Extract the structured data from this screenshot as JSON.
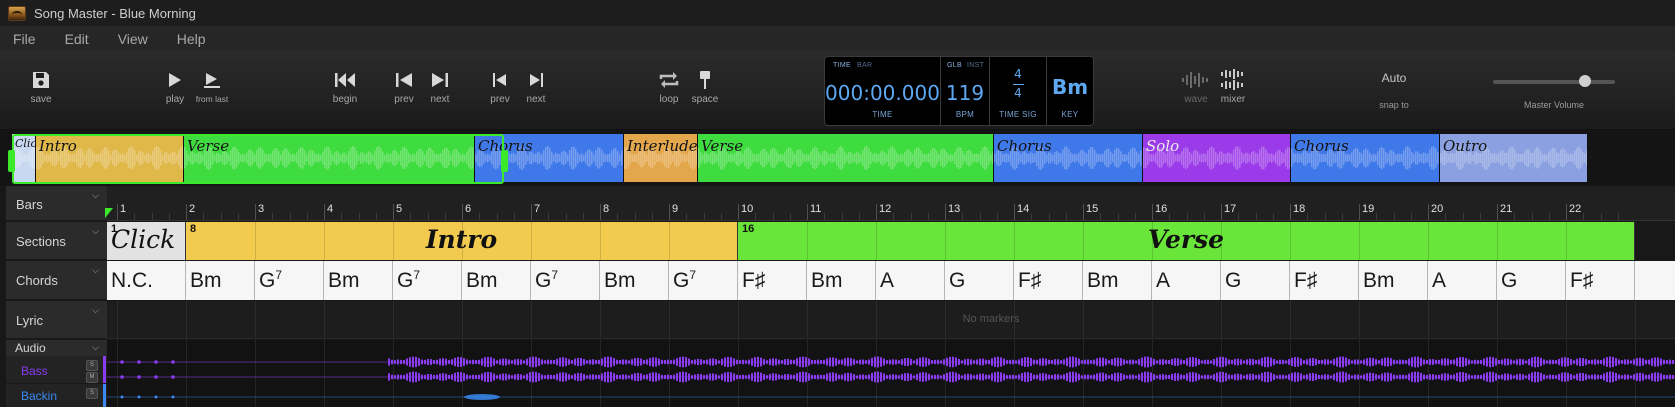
{
  "window": {
    "title": "Song Master - Blue Morning"
  },
  "menu": [
    "File",
    "Edit",
    "View",
    "Help"
  ],
  "toolbar": {
    "save": "save",
    "play": "play",
    "from_last": "from last",
    "begin": "begin",
    "prev_bar": "prev",
    "next_bar": "next",
    "prev_section": "prev",
    "next_section": "next",
    "loop": "loop",
    "space": "space",
    "wave": "wave",
    "mixer": "mixer"
  },
  "lcd": {
    "time_tag": "TIME",
    "bar_tag": "BAR",
    "time_value": "000:00.000",
    "time_label": "TIME",
    "glb_tag": "GLB",
    "inst_tag": "INST",
    "bpm_value": "119",
    "bpm_label": "BPM",
    "timesig_top": "4",
    "timesig_bottom": "4",
    "timesig_label": "TIME SIG",
    "key_value": "Bm",
    "key_label": "KEY"
  },
  "snap": {
    "value": "Auto",
    "label": "snap to"
  },
  "master_volume": {
    "label": "Master Volume",
    "level": 0.75
  },
  "overview_sections": [
    {
      "name": "Click",
      "color": "#c8d8f0"
    },
    {
      "name": "Intro",
      "color": "#e0b84a"
    },
    {
      "name": "Verse",
      "color": "#3fdc3f"
    },
    {
      "name": "Chorus",
      "color": "#3f78e8"
    },
    {
      "name": "Interlude",
      "color": "#e4a64a"
    },
    {
      "name": "Verse",
      "color": "#3fdc3f"
    },
    {
      "name": "Chorus",
      "color": "#3f78e8"
    },
    {
      "name": "Solo",
      "color": "#9a3ae8"
    },
    {
      "name": "Chorus",
      "color": "#3f78e8"
    },
    {
      "name": "Outro",
      "color": "#8aa0e0"
    }
  ],
  "track_headers": {
    "bars": "Bars",
    "sections": "Sections",
    "chords": "Chords",
    "lyric": "Lyric",
    "audio": "Audio"
  },
  "bar_numbers": [
    "1",
    "2",
    "3",
    "4",
    "5",
    "6",
    "7",
    "8",
    "9",
    "10",
    "11",
    "12",
    "13",
    "14",
    "15",
    "16",
    "17",
    "18",
    "19",
    "20",
    "21",
    "22"
  ],
  "sections": [
    {
      "number": "1",
      "name": "Click",
      "color": "#e2e2e2"
    },
    {
      "number": "8",
      "name": "Intro",
      "color": "#f2cb4e"
    },
    {
      "number": "16",
      "name": "Verse",
      "color": "#6ae63a"
    }
  ],
  "chords": [
    {
      "root": "N.C.",
      "ext": ""
    },
    {
      "root": "Bm",
      "ext": ""
    },
    {
      "root": "G",
      "ext": "7"
    },
    {
      "root": "Bm",
      "ext": ""
    },
    {
      "root": "G",
      "ext": "7"
    },
    {
      "root": "Bm",
      "ext": ""
    },
    {
      "root": "G",
      "ext": "7"
    },
    {
      "root": "Bm",
      "ext": ""
    },
    {
      "root": "G",
      "ext": "7"
    },
    {
      "root": "F♯",
      "ext": ""
    },
    {
      "root": "Bm",
      "ext": ""
    },
    {
      "root": "A",
      "ext": ""
    },
    {
      "root": "G",
      "ext": ""
    },
    {
      "root": "F♯",
      "ext": ""
    },
    {
      "root": "Bm",
      "ext": ""
    },
    {
      "root": "A",
      "ext": ""
    },
    {
      "root": "G",
      "ext": ""
    },
    {
      "root": "F♯",
      "ext": ""
    },
    {
      "root": "Bm",
      "ext": ""
    },
    {
      "root": "A",
      "ext": ""
    },
    {
      "root": "G",
      "ext": ""
    },
    {
      "root": "F♯",
      "ext": ""
    }
  ],
  "lyric": {
    "empty_text": "No markers"
  },
  "audio_tracks": [
    {
      "name": "Bass",
      "color": "#8a3cf0",
      "solo": "S",
      "mute": "M"
    },
    {
      "name": "Backin",
      "color": "#3a8af0",
      "solo": "S"
    }
  ]
}
